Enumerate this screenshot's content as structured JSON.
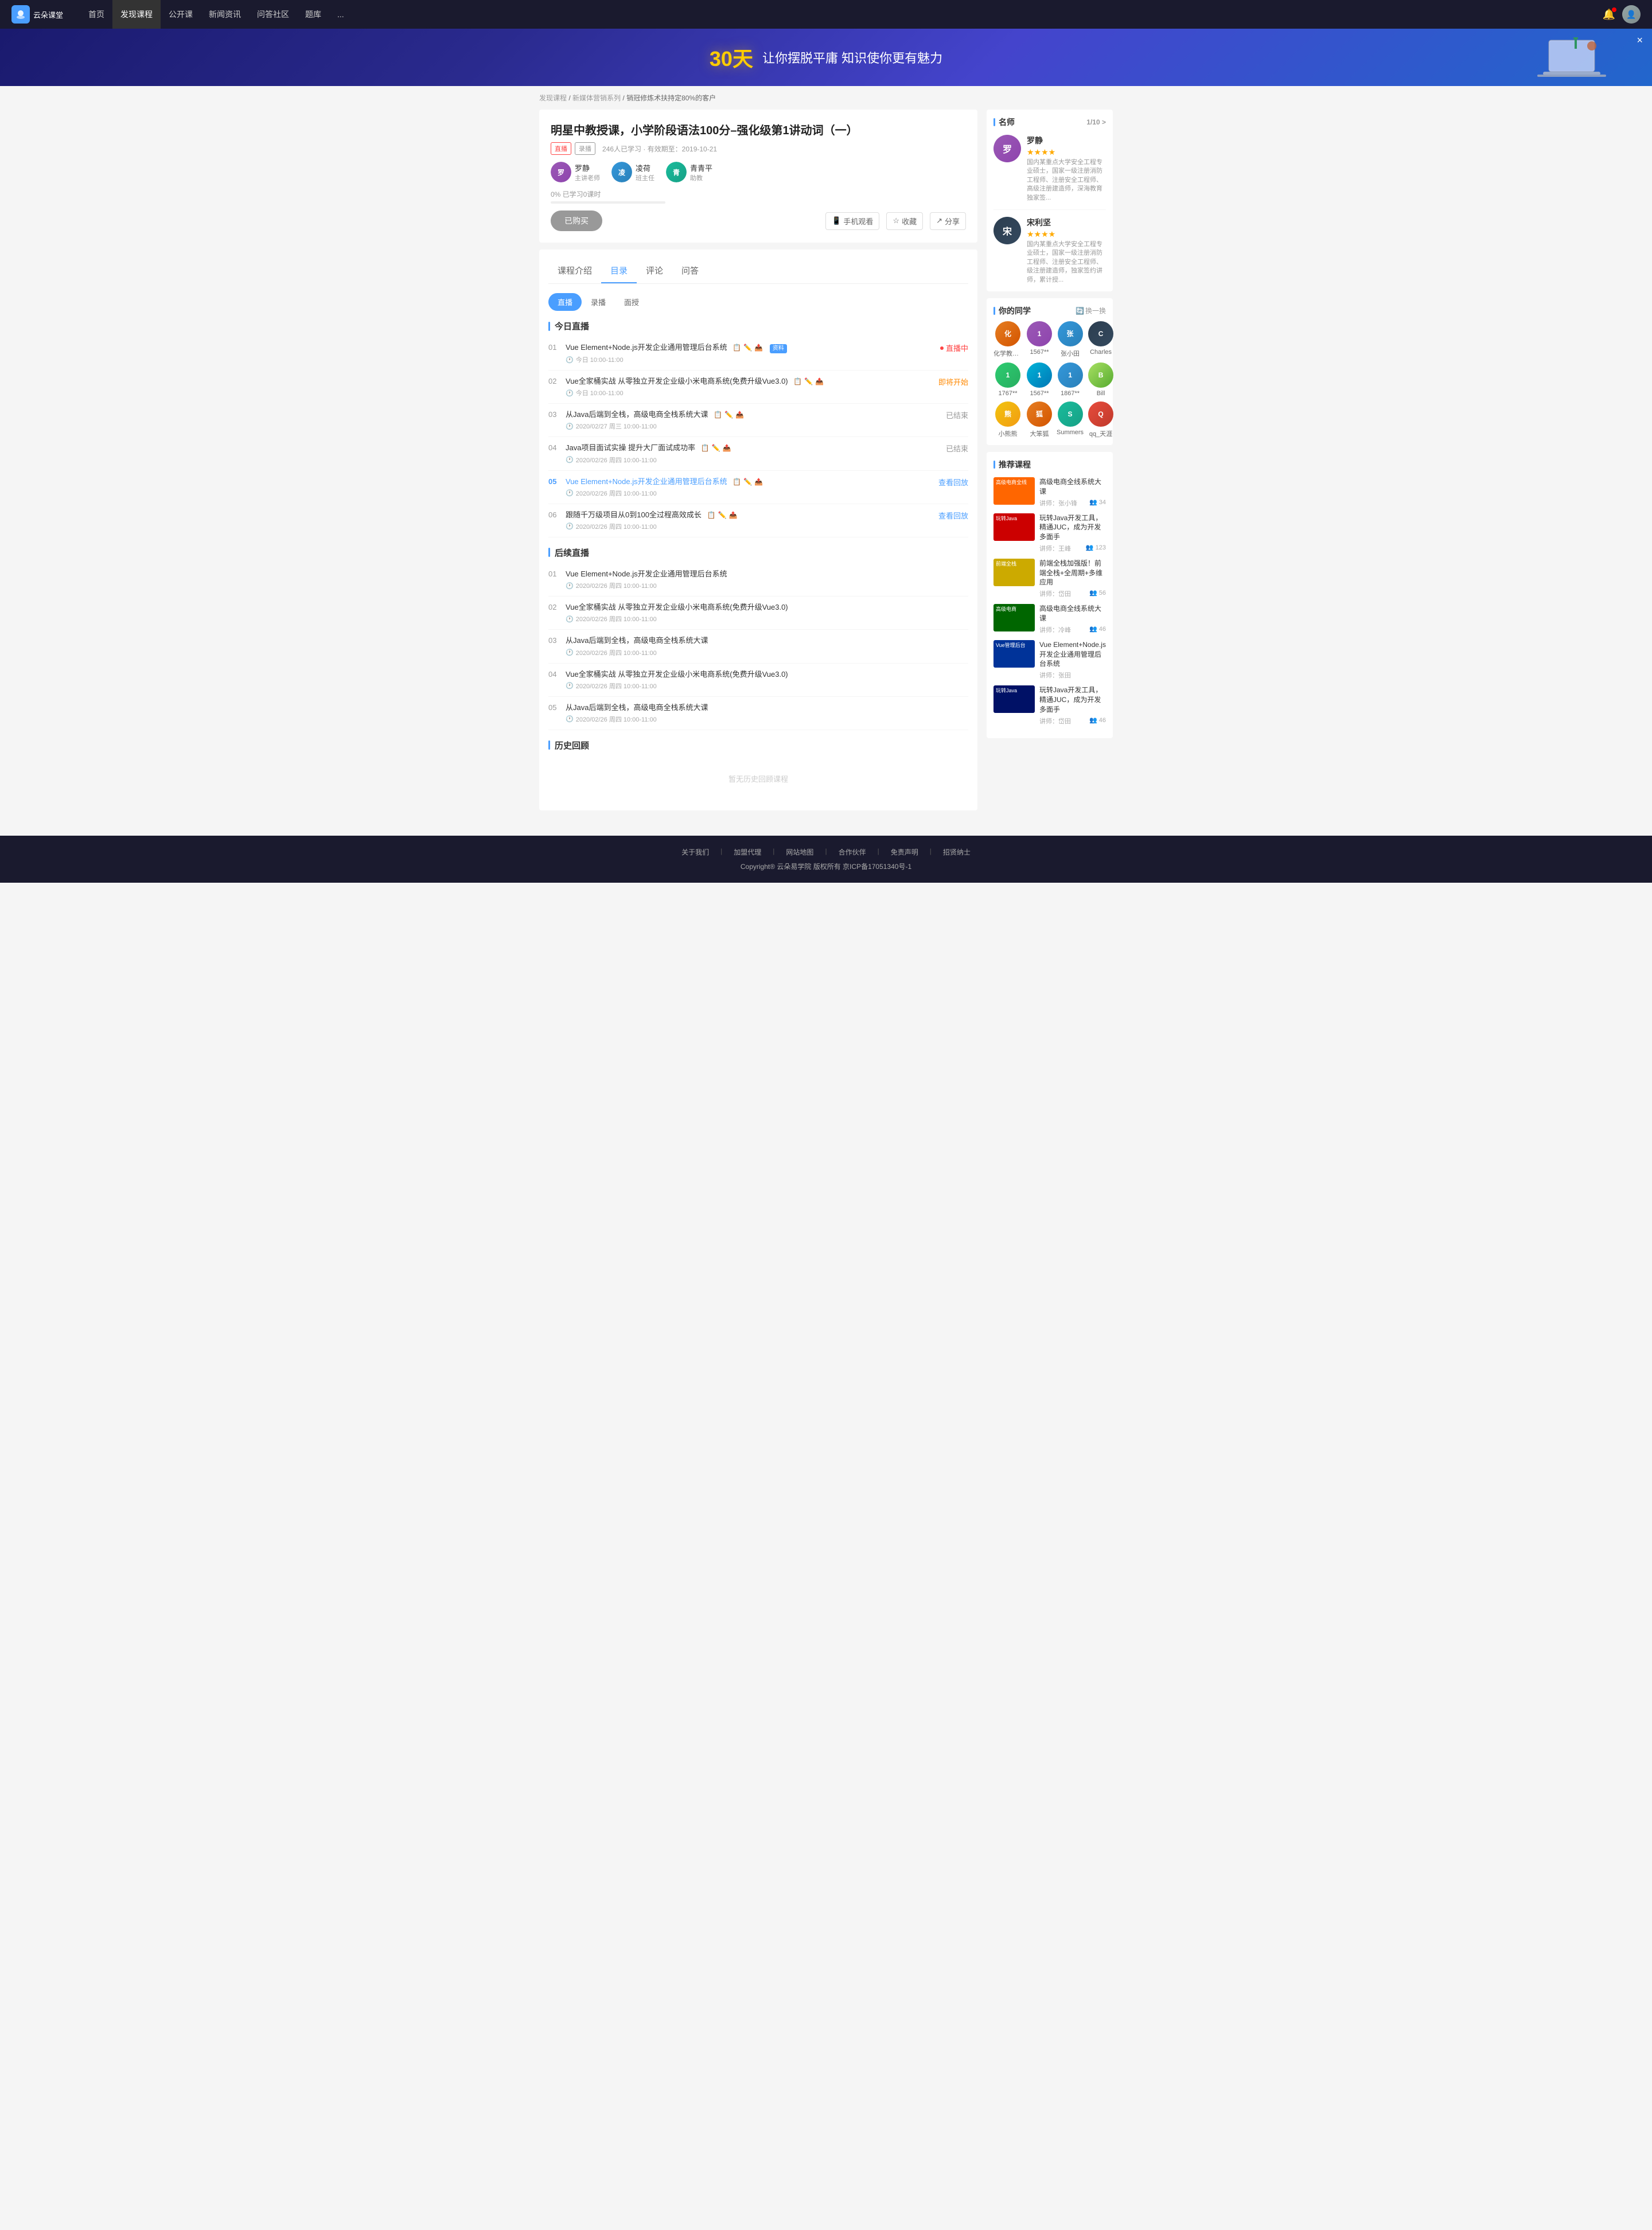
{
  "nav": {
    "logo_text": "云朵课堂",
    "links": [
      {
        "label": "首页",
        "active": false
      },
      {
        "label": "发现课程",
        "active": true
      },
      {
        "label": "公开课",
        "active": false
      },
      {
        "label": "新闻资讯",
        "active": false
      },
      {
        "label": "问答社区",
        "active": false
      },
      {
        "label": "题库",
        "active": false
      },
      {
        "label": "...",
        "active": false
      }
    ]
  },
  "banner": {
    "highlight": "30天",
    "text": " 让你摆脱平庸  知识使你更有魅力",
    "close_label": "×"
  },
  "breadcrumb": {
    "items": [
      "发现课程",
      "新媒体营销系列",
      "销冠修炼术扶持定80%的客户"
    ]
  },
  "course": {
    "title": "明星中教授课，小学阶段语法100分–强化级第1讲动词（一）",
    "tag_live": "直播",
    "tag_record": "录播",
    "meta": "246人已学习  · 有效期至：2019-10-21",
    "teachers": [
      {
        "name": "罗静",
        "role": "主讲老师",
        "initials": "罗",
        "color": "av-purple"
      },
      {
        "name": "凌荷",
        "role": "班主任",
        "initials": "凌",
        "color": "av-blue"
      },
      {
        "name": "青青平",
        "role": "助教",
        "initials": "青",
        "color": "av-teal"
      }
    ],
    "progress_label": "0%  已学习0课时",
    "btn_buy": "已购买",
    "btn_mobile": "手机观看",
    "btn_collect": "收藏",
    "btn_share": "分享"
  },
  "tabs": {
    "items": [
      "课程介绍",
      "目录",
      "评论",
      "问答"
    ],
    "active": 1
  },
  "sub_tabs": {
    "items": [
      "直播",
      "录播",
      "面授"
    ],
    "active": 0
  },
  "today_live": {
    "section_title": "今日直播",
    "lessons": [
      {
        "num": "01",
        "title": "Vue Element+Node.js开发企业通用管理后台系统",
        "icons": [
          "📋",
          "✏️",
          "📤"
        ],
        "tag": "资料",
        "time": "今日 10:00-11:00",
        "status": "直播中",
        "status_type": "live"
      },
      {
        "num": "02",
        "title": "Vue全家桶实战 从零独立开发企业级小米电商系统(免费升级Vue3.0)",
        "icons": [
          "📋",
          "✏️",
          "📤"
        ],
        "time": "今日 10:00-11:00",
        "status": "即将开始",
        "status_type": "soon"
      },
      {
        "num": "03",
        "title": "从Java后端到全栈，高级电商全栈系统大课",
        "icons": [
          "📋",
          "✏️",
          "📤"
        ],
        "time": "2020/02/27 周三 10:00-11:00",
        "status": "已结束",
        "status_type": "ended"
      },
      {
        "num": "04",
        "title": "Java项目面试实操 提升大厂面试成功率",
        "icons": [
          "📋",
          "✏️",
          "📤"
        ],
        "time": "2020/02/26 周四 10:00-11:00",
        "status": "已结束",
        "status_type": "ended"
      },
      {
        "num": "05",
        "title": "Vue Element+Node.js开发企业通用管理后台系统",
        "icons": [
          "📋",
          "✏️",
          "📤"
        ],
        "time": "2020/02/26 周四 10:00-11:00",
        "status": "查看回放",
        "status_type": "replay",
        "highlight": true
      },
      {
        "num": "06",
        "title": "跟随千万级项目从0到100全过程高效成长",
        "icons": [
          "📋",
          "✏️",
          "📤"
        ],
        "time": "2020/02/26 周四 10:00-11:00",
        "status": "查看回放",
        "status_type": "replay"
      }
    ]
  },
  "future_live": {
    "section_title": "后续直播",
    "lessons": [
      {
        "num": "01",
        "title": "Vue Element+Node.js开发企业通用管理后台系统",
        "time": "2020/02/26 周四 10:00-11:00"
      },
      {
        "num": "02",
        "title": "Vue全家桶实战 从零独立开发企业级小米电商系统(免费升级Vue3.0)",
        "time": "2020/02/26 周四 10:00-11:00"
      },
      {
        "num": "03",
        "title": "从Java后端到全栈，高级电商全栈系统大课",
        "time": "2020/02/26 周四 10:00-11:00"
      },
      {
        "num": "04",
        "title": "Vue全家桶实战 从零独立开发企业级小米电商系统(免费升级Vue3.0)",
        "time": "2020/02/26 周四 10:00-11:00"
      },
      {
        "num": "05",
        "title": "从Java后端到全栈，高级电商全栈系统大课",
        "time": "2020/02/26 周四 10:00-11:00"
      }
    ]
  },
  "history": {
    "section_title": "历史回顾",
    "empty_text": "暂无历史回顾课程"
  },
  "sidebar": {
    "teachers_title": "名师",
    "teachers_nav": "1/10 >",
    "teachers": [
      {
        "name": "罗静",
        "stars": "★★★★",
        "desc": "国内某重点大学安全工程专业硕士，国家一级注册消防工程师、注册安全工程师、高级注册建造师，深海教育独家签...",
        "initials": "罗",
        "color": "av-purple"
      },
      {
        "name": "宋利坚",
        "stars": "★★★★",
        "desc": "国内某重点大学安全工程专业硕士，国家一级注册消防工程师、注册安全工程师、级注册建造师，独家签约讲师，累计授...",
        "initials": "宋",
        "color": "av-dark"
      }
    ],
    "classmates_title": "你的同学",
    "swap_label": "换一换",
    "classmates": [
      {
        "name": "化学教书...",
        "initials": "化",
        "color": "av-orange"
      },
      {
        "name": "1567**",
        "initials": "1",
        "color": "av-purple"
      },
      {
        "name": "张小田",
        "initials": "张",
        "color": "av-blue"
      },
      {
        "name": "Charles",
        "initials": "C",
        "color": "av-dark"
      },
      {
        "name": "1767**",
        "initials": "1",
        "color": "av-green"
      },
      {
        "name": "1567**",
        "initials": "1",
        "color": "av-cyan"
      },
      {
        "name": "1867**",
        "initials": "1",
        "color": "av-blue"
      },
      {
        "name": "Bill",
        "initials": "B",
        "color": "av-lime"
      },
      {
        "name": "小熊熊",
        "initials": "熊",
        "color": "av-yellow"
      },
      {
        "name": "大笨狐",
        "initials": "狐",
        "color": "av-orange"
      },
      {
        "name": "Summers",
        "initials": "S",
        "color": "av-teal"
      },
      {
        "name": "qq_天涯",
        "initials": "Q",
        "color": "av-red"
      }
    ],
    "recommended_title": "推荐课程",
    "recommended": [
      {
        "title": "高级电商全线系统大课",
        "lecturer": "讲师：张小锋",
        "students": "34",
        "thumb_color": "thumb-orange",
        "thumb_text": "高级电商全线"
      },
      {
        "title": "玩转Java开发工具，精通JUC，成为开发多面手",
        "lecturer": "讲师：王峰",
        "students": "123",
        "thumb_color": "thumb-red",
        "thumb_text": "玩转Java"
      },
      {
        "title": "前端全栈加强版！前端全栈+全周期+多维应用",
        "lecturer": "讲师：岱田",
        "students": "56",
        "thumb_color": "thumb-yellow",
        "thumb_text": "前端全栈"
      },
      {
        "title": "高级电商全线系统大课",
        "lecturer": "讲师：冷峰",
        "students": "46",
        "thumb_color": "thumb-green",
        "thumb_text": "高级电商"
      },
      {
        "title": "Vue Element+Node.js开发企业通用管理后台系统",
        "lecturer": "讲师：张田",
        "students": "",
        "thumb_color": "thumb-blue",
        "thumb_text": "Vue管理后台"
      },
      {
        "title": "玩转Java开发工具，精通JUC，成为开发多面手",
        "lecturer": "讲师：岱田",
        "students": "46",
        "thumb_color": "thumb-darkblue",
        "thumb_text": "玩转Java"
      }
    ]
  },
  "footer": {
    "links": [
      "关于我们",
      "加盟代理",
      "网站地图",
      "合作伙伴",
      "免责声明",
      "招贤纳士"
    ],
    "copyright": "Copyright® 云朵易学院  版权所有  京ICP备17051340号-1"
  }
}
